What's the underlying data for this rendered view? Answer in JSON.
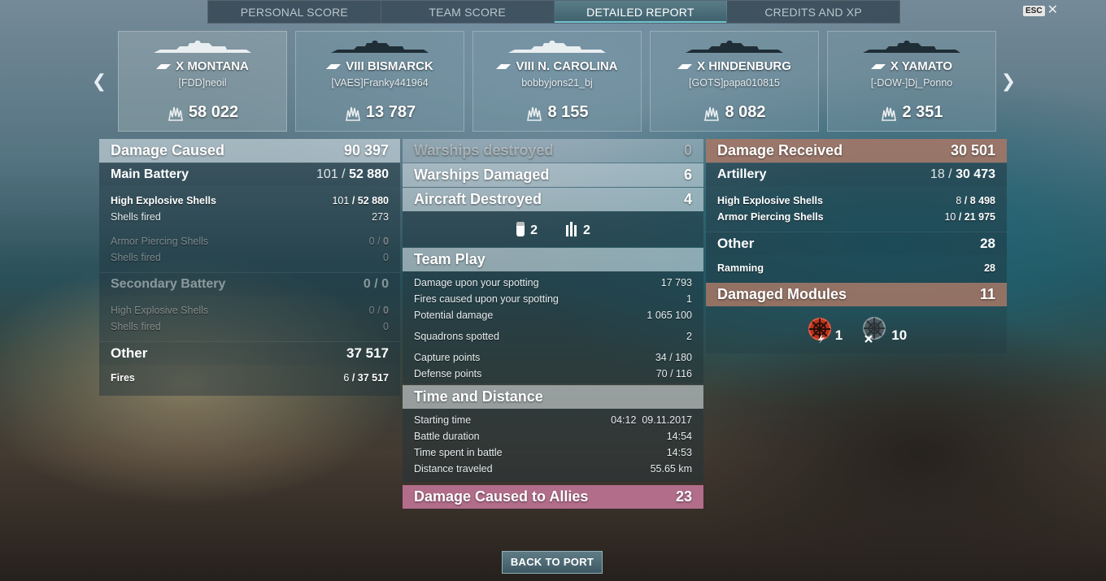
{
  "tabs": [
    {
      "label": "PERSONAL SCORE"
    },
    {
      "label": "TEAM SCORE"
    },
    {
      "label": "DETAILED REPORT",
      "active": true
    },
    {
      "label": "CREDITS AND XP"
    }
  ],
  "esc": {
    "key": "ESC",
    "close": "✕"
  },
  "ships": [
    {
      "name": "X MONTANA",
      "player": "[FDD]neoil",
      "damage": "58 022",
      "active": true
    },
    {
      "name": "VIII BISMARCK",
      "player": "[VAES]Franky441964",
      "damage": "13 787"
    },
    {
      "name": "VIII N. CAROLINA",
      "player": "bobbyjons21_bj",
      "damage": "8 155"
    },
    {
      "name": "X HINDENBURG",
      "player": "[GOTS]papa010815",
      "damage": "8 082"
    },
    {
      "name": "X YAMATO",
      "player": "[-DOW-]Dj_Ponno",
      "damage": "2 351"
    }
  ],
  "left": {
    "damage_caused": {
      "label": "Damage Caused",
      "value": "90 397"
    },
    "main_battery": {
      "label": "Main Battery",
      "hits": "101",
      "sep": " / ",
      "value": "52 880"
    },
    "mb_he": {
      "label": "High Explosive Shells",
      "hits": "101",
      "value": "52 880"
    },
    "mb_he_fired": {
      "label": "Shells fired",
      "value": "273"
    },
    "mb_ap": {
      "label": "Armor Piercing Shells",
      "hits": "0",
      "value": "0"
    },
    "mb_ap_fired": {
      "label": "Shells fired",
      "value": "0"
    },
    "secondary": {
      "label": "Secondary Battery",
      "hits": "0",
      "value": "0"
    },
    "sec_he": {
      "label": "High Explosive Shells",
      "hits": "0",
      "value": "0"
    },
    "sec_he_fired": {
      "label": "Shells fired",
      "value": "0"
    },
    "other": {
      "label": "Other",
      "value": "37 517"
    },
    "fires": {
      "label": "Fires",
      "hits": "6",
      "value": "37 517"
    }
  },
  "middle": {
    "warships_destroyed": {
      "label": "Warships destroyed",
      "value": "0"
    },
    "warships_damaged": {
      "label": "Warships Damaged",
      "value": "6"
    },
    "aircraft_destroyed": {
      "label": "Aircraft Destroyed",
      "value": "4"
    },
    "aircraft_icons": [
      {
        "icon": "fighter-plane-icon",
        "count": "2"
      },
      {
        "icon": "torpedo-bomber-icon",
        "count": "2"
      }
    ],
    "team_play": {
      "title": "Team Play",
      "rows": [
        {
          "label": "Damage upon your spotting",
          "value": "17 793"
        },
        {
          "label": "Fires caused upon your spotting",
          "value": "1"
        },
        {
          "label": "Potential damage",
          "value": "1 065 100"
        },
        {
          "label": "Squadrons spotted",
          "value": "2"
        },
        {
          "label": "Capture points",
          "value": "34 / 180"
        },
        {
          "label": "Defense points",
          "value": "70 / 116"
        }
      ]
    },
    "time_distance": {
      "title": "Time and Distance",
      "rows": [
        {
          "label": "Starting time",
          "value": "04:12  09.11.2017"
        },
        {
          "label": "Battle duration",
          "value": "14:54"
        },
        {
          "label": "Time spent in battle",
          "value": "14:53"
        },
        {
          "label": "Distance traveled",
          "value": "55.65 km"
        }
      ]
    },
    "allies": {
      "label": "Damage Caused to Allies",
      "value": "23"
    }
  },
  "right": {
    "damage_received": {
      "label": "Damage Received",
      "value": "30 501"
    },
    "artillery": {
      "label": "Artillery",
      "hits": "18",
      "value": "30 473"
    },
    "he": {
      "label": "High Explosive Shells",
      "hits": "8",
      "value": "8 498"
    },
    "ap": {
      "label": "Armor Piercing Shells",
      "hits": "10",
      "value": "21 975"
    },
    "other": {
      "label": "Other",
      "value": "28"
    },
    "ramming": {
      "label": "Ramming",
      "value": "28"
    },
    "modules": {
      "label": "Damaged Modules",
      "value": "11"
    },
    "module_icons": [
      {
        "icon": "steering-gear-damaged-icon",
        "count": "1"
      },
      {
        "icon": "engine-destroyed-icon",
        "count": "10"
      }
    ]
  },
  "back_button": "BACK TO PORT",
  "colors": {
    "accent": "#6ec3cf",
    "received": "#af7864",
    "allies": "#c8789b"
  }
}
